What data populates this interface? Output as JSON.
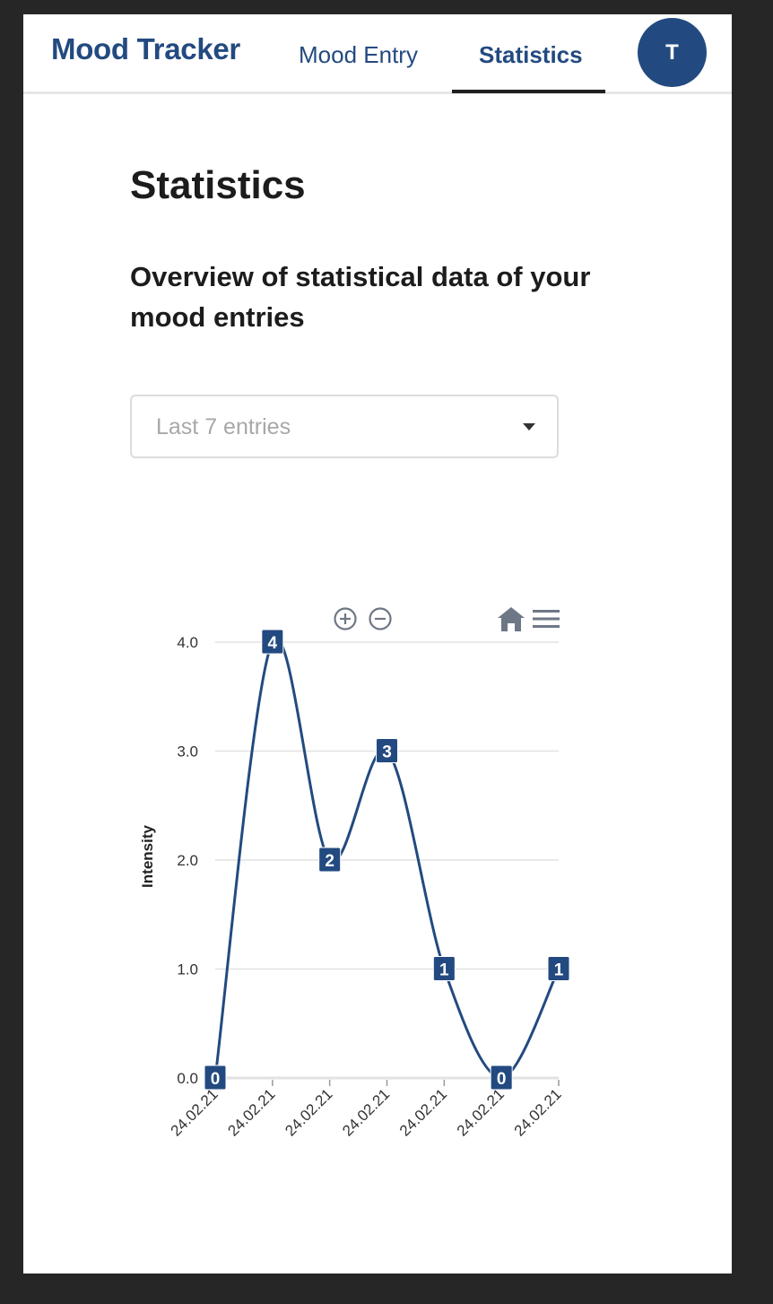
{
  "app": {
    "brand": "Mood Tracker",
    "nav": [
      {
        "label": "Mood Entry",
        "active": false
      },
      {
        "label": "Statistics",
        "active": true
      }
    ],
    "avatar_initial": "T",
    "accent_color": "#234a80"
  },
  "page": {
    "title": "Statistics",
    "subtitle": "Overview of statistical data of your mood entries"
  },
  "filter": {
    "selected": "Last 7 entries",
    "icon": "caret-down-icon"
  },
  "toolbar": {
    "icons": [
      "zoom-in-icon",
      "zoom-out-icon",
      "home-icon",
      "menu-icon"
    ]
  },
  "chart_data": {
    "type": "line",
    "x": [
      "24.02.21",
      "24.02.21",
      "24.02.21",
      "24.02.21",
      "24.02.21",
      "24.02.21",
      "24.02.21"
    ],
    "series": [
      {
        "values": [
          0,
          4,
          2,
          3,
          1,
          0,
          1
        ],
        "color": "#234a80"
      }
    ],
    "ylabel": "Intensity",
    "xlabel": "",
    "ylim": [
      0,
      4
    ],
    "yticks": [
      "0.0",
      "1.0",
      "2.0",
      "3.0",
      "4.0"
    ],
    "data_labels": [
      "0",
      "4",
      "2",
      "3",
      "1",
      "0",
      "1"
    ],
    "grid": true,
    "smooth": true,
    "legend": "none"
  }
}
